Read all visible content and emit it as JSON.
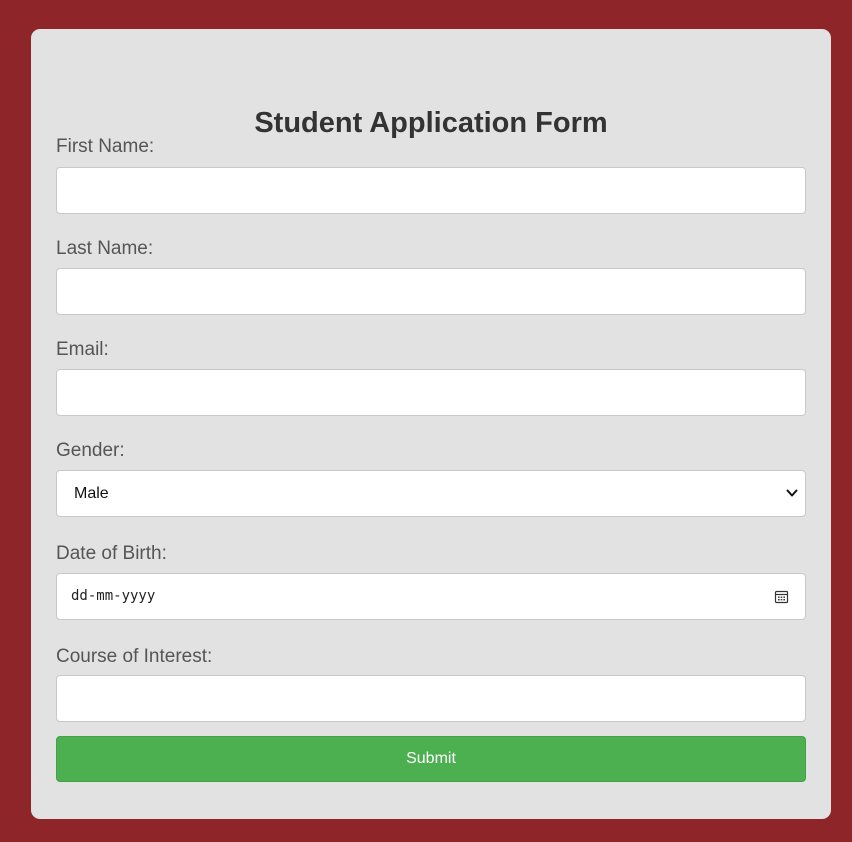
{
  "form": {
    "title": "Student Application Form",
    "fields": {
      "first_name": {
        "label": "First Name:",
        "value": ""
      },
      "last_name": {
        "label": "Last Name:",
        "value": ""
      },
      "email": {
        "label": "Email:",
        "value": ""
      },
      "gender": {
        "label": "Gender:",
        "selected": "Male"
      },
      "dob": {
        "label": "Date of Birth:",
        "placeholder": "dd-mm-yyyy"
      },
      "course": {
        "label": "Course of Interest:",
        "value": ""
      }
    },
    "submit_label": "Submit"
  },
  "colors": {
    "background": "#8e2528",
    "card": "#e2e2e2",
    "submit": "#4caf50"
  },
  "icons": {
    "gender_dropdown": "chevron-down-icon",
    "dob_picker": "calendar-icon"
  }
}
